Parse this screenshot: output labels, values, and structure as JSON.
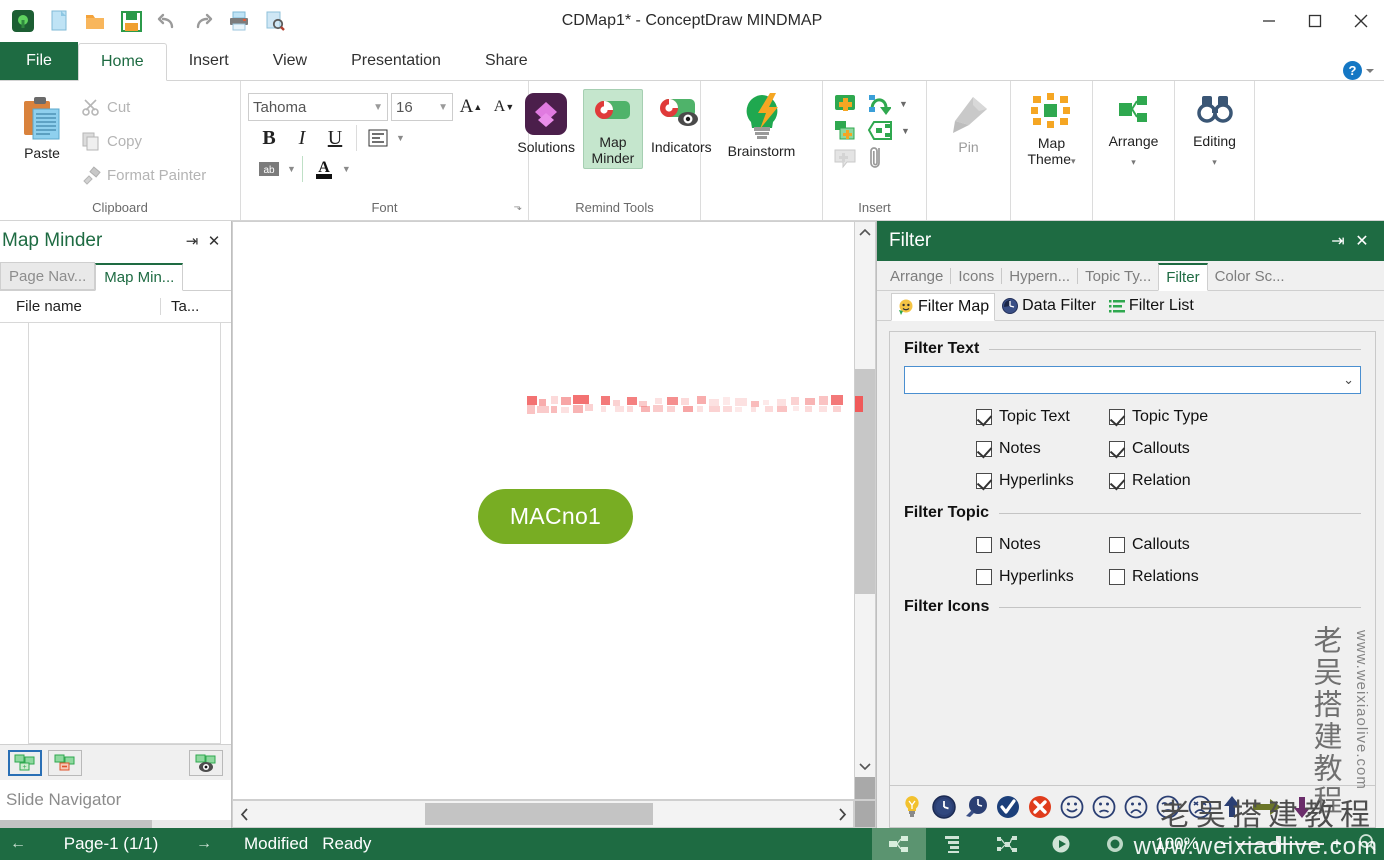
{
  "window": {
    "title": "CDMap1* - ConceptDraw MINDMAP",
    "minimize_label": "—",
    "maximize_label": "□",
    "close_label": "✕"
  },
  "quick_access": [
    {
      "name": "app-logo-icon",
      "glyph": "🔅"
    },
    {
      "name": "new-document-icon",
      "glyph": "🗎"
    },
    {
      "name": "open-folder-icon",
      "glyph": "📁"
    },
    {
      "name": "save-icon",
      "glyph": "💾"
    },
    {
      "name": "undo-icon",
      "glyph": "↶"
    },
    {
      "name": "redo-icon",
      "glyph": "↷"
    },
    {
      "name": "print-icon",
      "glyph": "🖨"
    },
    {
      "name": "print-preview-icon",
      "glyph": "🔍"
    }
  ],
  "ribbon": {
    "tabs": [
      {
        "label": "File",
        "active": false,
        "file": true
      },
      {
        "label": "Home",
        "active": true
      },
      {
        "label": "Insert",
        "active": false
      },
      {
        "label": "View",
        "active": false
      },
      {
        "label": "Presentation",
        "active": false
      },
      {
        "label": "Share",
        "active": false
      }
    ],
    "help_label": "?",
    "clipboard": {
      "group_label": "Clipboard",
      "paste_label": "Paste",
      "cut_label": "Cut",
      "copy_label": "Copy",
      "format_painter_label": "Format Painter"
    },
    "font": {
      "group_label": "Font",
      "font_family_value": "Tahoma",
      "font_size_value": "16",
      "grow_font_label": "A",
      "shrink_font_label": "A",
      "bold_label": "B",
      "italic_label": "I",
      "underline_label": "U",
      "paragraph_label": "☰",
      "highlight_label": "ab",
      "font_color_label": "A",
      "dialog_launcher_label": "⬎"
    },
    "remind_tools": {
      "group_label": "Remind Tools",
      "solutions_label": "Solutions",
      "map_minder_label": "Map\nMinder",
      "map_minder_line1": "Map",
      "map_minder_line2": "Minder",
      "indicators_label": "Indicators",
      "brainstorm_label": "Brainstorm"
    },
    "insert": {
      "group_label": "Insert",
      "add_topic_label": "",
      "add_subtopic_label": "",
      "relation_label": "",
      "boundary_label": "",
      "callout_label": "",
      "attachment_label": ""
    },
    "pin": {
      "label": "Pin"
    },
    "map_theme": {
      "label_line1": "Map",
      "label_line2": "Theme"
    },
    "arrange": {
      "label": "Arrange"
    },
    "editing": {
      "label": "Editing"
    }
  },
  "left_panel": {
    "title": "Map Minder",
    "pin_label": "⇥",
    "close_label": "✕",
    "tabs": [
      {
        "label": "Page Nav...",
        "active": false
      },
      {
        "label": "Map Min...",
        "active": true
      }
    ],
    "columns": [
      "File name",
      "Ta..."
    ],
    "rows": [],
    "toolbar_buttons": [
      {
        "name": "add-map-button",
        "selected": true
      },
      {
        "name": "remove-map-button",
        "selected": false
      },
      {
        "name": "preview-map-button",
        "selected": false
      }
    ],
    "slide_navigator_label": "Slide Navigator"
  },
  "canvas": {
    "node_label": "MACno1",
    "node_color": "#78ad23",
    "node_text_color": "#ffffff",
    "blurred_text_color": "#f05a5a",
    "scroll_left_label": "‹",
    "scroll_right_label": "›",
    "scroll_up_label": "⌃",
    "scroll_down_label": "⌄"
  },
  "filter_panel": {
    "title": "Filter",
    "pin_label": "⇥",
    "close_label": "✕",
    "tabs": [
      {
        "label": "Arrange",
        "active": false
      },
      {
        "label": "Icons",
        "active": false
      },
      {
        "label": "Hypern...",
        "active": false
      },
      {
        "label": "Topic Ty...",
        "active": false
      },
      {
        "label": "Filter",
        "active": true
      },
      {
        "label": "Color Sc...",
        "active": false
      }
    ],
    "subtabs": [
      {
        "label": "Filter Map",
        "icon": "filter-map-icon",
        "active": true
      },
      {
        "label": "Data Filter",
        "icon": "data-filter-icon",
        "active": false
      },
      {
        "label": "Filter List",
        "icon": "filter-list-icon",
        "active": false
      }
    ],
    "filter_text": {
      "section_label": "Filter Text",
      "input_value": "",
      "input_placeholder": "",
      "checkboxes": [
        {
          "label": "Topic Text",
          "checked": true
        },
        {
          "label": "Topic Type",
          "checked": true
        },
        {
          "label": "Notes",
          "checked": true
        },
        {
          "label": "Callouts",
          "checked": true
        },
        {
          "label": "Hyperlinks",
          "checked": true
        },
        {
          "label": "Relation",
          "checked": true
        }
      ]
    },
    "filter_topic": {
      "section_label": "Filter Topic",
      "checkboxes": [
        {
          "label": "Notes",
          "checked": false
        },
        {
          "label": "Callouts",
          "checked": false
        },
        {
          "label": "Hyperlinks",
          "checked": false
        },
        {
          "label": "Relations",
          "checked": false
        }
      ]
    },
    "filter_icons": {
      "section_label": "Filter Icons",
      "icons": [
        {
          "name": "lightbulb-icon",
          "glyph": "💡",
          "color": "#f2c12e"
        },
        {
          "name": "clock-icon",
          "glyph": "🕐",
          "color": "#2b3f73"
        },
        {
          "name": "magnifier-clock-icon",
          "glyph": "🔎",
          "color": "#2b3f73"
        },
        {
          "name": "checkmark-circle-icon",
          "glyph": "✔",
          "color": "#1c3f7a"
        },
        {
          "name": "error-circle-icon",
          "glyph": "✖",
          "color": "#e03c1c"
        },
        {
          "name": "smiley-happy-icon",
          "glyph": "☺",
          "color": "#2b3f73"
        },
        {
          "name": "smiley-slight-frown-icon",
          "glyph": "☹",
          "color": "#2b3f73"
        },
        {
          "name": "smiley-frown-icon",
          "glyph": "☹",
          "color": "#2b3f73"
        },
        {
          "name": "smiley-worried-icon",
          "glyph": "☹",
          "color": "#2b3f73"
        },
        {
          "name": "smiley-distressed-icon",
          "glyph": "☹",
          "color": "#2b3f73"
        },
        {
          "name": "arrow-up-icon",
          "glyph": "⬆",
          "color": "#2b3f73"
        },
        {
          "name": "arrow-right-icon",
          "glyph": "➡",
          "color": "#6b7528"
        },
        {
          "name": "arrow-down-icon",
          "glyph": "⬇",
          "color": "#6b2d6b"
        }
      ]
    }
  },
  "status_bar": {
    "prev_page_label": "←",
    "page_label": "Page-1 (1/1)",
    "next_page_label": "→",
    "modified_label": "Modified",
    "ready_label": "Ready",
    "zoom_label": "100%",
    "zoom_out_label": "−",
    "zoom_in_label": "+",
    "fit_label": "🔍",
    "view_buttons": [
      {
        "name": "mind-map-view-button",
        "selected": true
      },
      {
        "name": "outline-view-button",
        "selected": false
      },
      {
        "name": "tree-view-button",
        "selected": false
      },
      {
        "name": "presentation-view-button",
        "selected": false
      },
      {
        "name": "brainstorm-view-button",
        "selected": false
      }
    ]
  },
  "watermarks": {
    "vertical_cn": "老吴搭建教程",
    "vertical_url": "www.weixiaolive.com",
    "bottom_cn": "老吴搭建教程",
    "bottom_url": "www.weixiaolive.com"
  }
}
